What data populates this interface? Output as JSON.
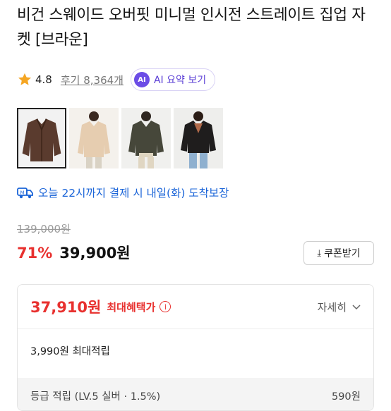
{
  "product": {
    "title": "비건 스웨이드 오버핏 미니멀 인시전 스트레이트 집업 자켓 [브라운]",
    "rating": "4.8",
    "reviews": "후기 8,364개",
    "ai_badge": "AI",
    "ai_summary_label": "AI 요약 보기"
  },
  "thumbnails": [
    {
      "name": "thumb-brown-jacket",
      "selected": true
    },
    {
      "name": "thumb-beige-jacket",
      "selected": false
    },
    {
      "name": "thumb-khaki-jacket",
      "selected": false
    },
    {
      "name": "thumb-black-jacket",
      "selected": false
    }
  ],
  "delivery": {
    "icon": "truck-icon",
    "text": "오늘 22시까지 결제 시 내일(화) 도착보장"
  },
  "pricing": {
    "original": "139,000원",
    "discount": "71%",
    "price": "39,900원",
    "coupon_label": "쿠폰받기"
  },
  "benefit": {
    "best_price": "37,910원",
    "best_label": "최대혜택가",
    "detail_label": "자세히",
    "points": "3,990원 최대적립",
    "grade_label": "등급 적립 (LV.5 실버 · 1.5%)",
    "grade_value": "590원"
  },
  "colors": {
    "accent_red": "#e8312f",
    "delivery_blue": "#1a64d8",
    "ai_purple": "#6b4ce6",
    "star": "#f5a623"
  }
}
